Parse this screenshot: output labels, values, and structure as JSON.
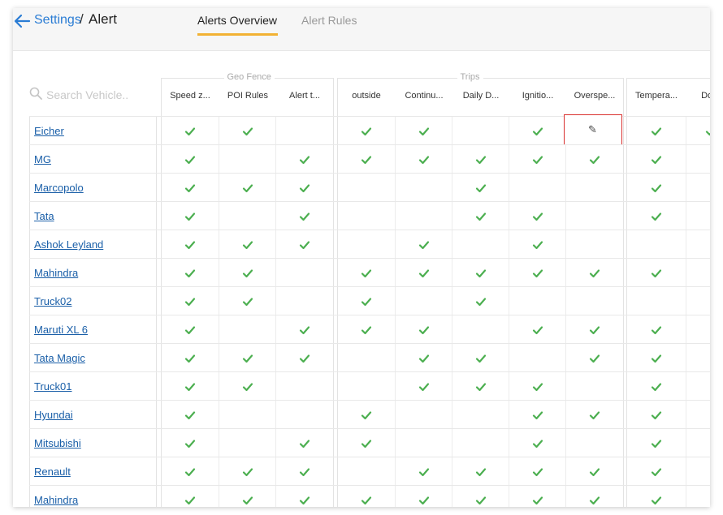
{
  "header": {
    "back_icon": "arrow-left-icon",
    "breadcrumb_parent": "Settings",
    "breadcrumb_separator": "/",
    "breadcrumb_current": "Alert",
    "tabs": [
      {
        "label": "Alerts Overview",
        "active": true
      },
      {
        "label": "Alert Rules",
        "active": false
      }
    ],
    "accent_color": "#f2b233",
    "link_color": "#2a7cd4"
  },
  "search": {
    "placeholder": "Search Vehicle.."
  },
  "groups": [
    {
      "title": "Geo Fence",
      "columns": [
        "Speed z...",
        "POI Rules",
        "Alert t..."
      ]
    },
    {
      "title": "Trips",
      "columns": [
        "outside",
        "Continu...",
        "Daily D...",
        "Ignitio...",
        "Overspe..."
      ]
    },
    {
      "title": "",
      "columns": [
        "Tempera...",
        "Door"
      ]
    }
  ],
  "vehicles": [
    {
      "name": "Eicher",
      "checks": [
        1,
        1,
        0,
        1,
        1,
        0,
        1,
        2,
        1,
        1
      ]
    },
    {
      "name": "MG",
      "checks": [
        1,
        0,
        1,
        1,
        1,
        1,
        1,
        1,
        1,
        0
      ]
    },
    {
      "name": "Marcopolo",
      "checks": [
        1,
        1,
        1,
        0,
        0,
        1,
        0,
        0,
        1,
        0
      ]
    },
    {
      "name": "Tata",
      "checks": [
        1,
        0,
        1,
        0,
        0,
        1,
        1,
        0,
        1,
        0
      ]
    },
    {
      "name": "Ashok Leyland",
      "checks": [
        1,
        1,
        1,
        0,
        1,
        0,
        1,
        0,
        0,
        0
      ]
    },
    {
      "name": "Mahindra",
      "checks": [
        1,
        1,
        0,
        1,
        1,
        1,
        1,
        1,
        1,
        0
      ]
    },
    {
      "name": "Truck02",
      "checks": [
        1,
        1,
        0,
        1,
        0,
        1,
        0,
        0,
        0,
        0
      ]
    },
    {
      "name": "Maruti XL 6",
      "checks": [
        1,
        0,
        1,
        1,
        1,
        0,
        1,
        1,
        1,
        0
      ]
    },
    {
      "name": "Tata Magic",
      "checks": [
        1,
        1,
        1,
        0,
        1,
        1,
        0,
        1,
        1,
        0
      ]
    },
    {
      "name": "Truck01",
      "checks": [
        1,
        1,
        0,
        0,
        1,
        1,
        1,
        0,
        1,
        0
      ]
    },
    {
      "name": "Hyundai",
      "checks": [
        1,
        0,
        0,
        1,
        0,
        0,
        1,
        1,
        1,
        0
      ]
    },
    {
      "name": "Mitsubishi",
      "checks": [
        1,
        0,
        1,
        1,
        0,
        0,
        1,
        0,
        1,
        0
      ]
    },
    {
      "name": "Renault",
      "checks": [
        1,
        1,
        1,
        0,
        1,
        1,
        1,
        1,
        1,
        0
      ]
    },
    {
      "name": "Mahindra",
      "checks": [
        1,
        1,
        1,
        1,
        1,
        1,
        1,
        1,
        1,
        0
      ]
    }
  ],
  "icons": {
    "check": "check-icon",
    "edit": "pencil-icon",
    "search": "search-icon"
  },
  "check_color": "#4caf50",
  "highlight_color": "#d9302e"
}
